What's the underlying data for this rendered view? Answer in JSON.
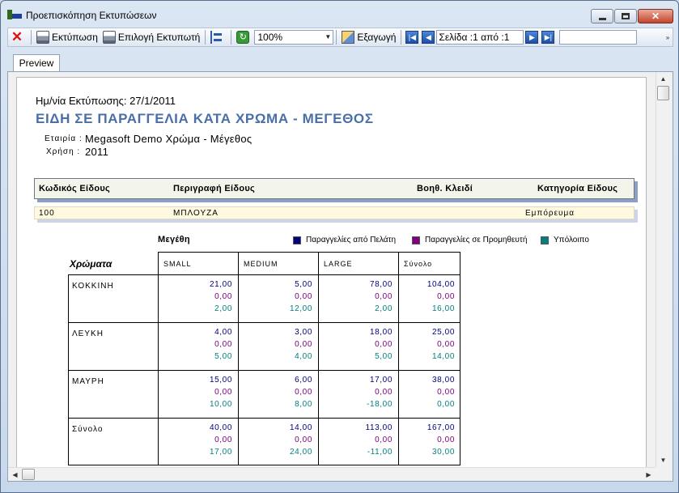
{
  "window": {
    "title": "Προεπισκόπηση Εκτυπώσεων"
  },
  "toolbar": {
    "print_label": "Εκτύπωση",
    "select_printer_label": "Επιλογή Εκτυπωτή",
    "zoom_value": "100%",
    "export_label": "Εξαγωγή",
    "page_indicator": "Σελίδα :1 από :1"
  },
  "tabs": [
    {
      "label": "Preview"
    }
  ],
  "report": {
    "print_date": "Ημ/νία Εκτύπωσης: 27/1/2011",
    "title": "ΕΙΔΗ ΣΕ ΠΑΡΑΓΓΕΛΙΑ ΚΑΤΑ ΧΡΩΜΑ - ΜΕΓΕΘΟΣ",
    "company_label": "Εταιρία :",
    "company_value": "Megasoft Demo Χρώμα - Μέγεθος",
    "year_label": "Χρήση :",
    "year_value": "2011",
    "columns": {
      "code": "Κωδικός Είδους",
      "description": "Περιγραφή Είδους",
      "aux_key": "Βοηθ. Κλειδί",
      "category": "Κατηγορία Είδους"
    },
    "item": {
      "code": "100",
      "description": "ΜΠΛΟΥΖΑ",
      "aux_key": "",
      "category": "Εμπόρευμα"
    },
    "matrix": {
      "sizes_title": "Μεγέθη",
      "colors_title": "Χρώματα",
      "legend": [
        {
          "label": "Παραγγελίες από Πελάτη",
          "color": "#000080"
        },
        {
          "label": "Παραγγελίες σε Προμηθευτή",
          "color": "#800080"
        },
        {
          "label": "Υπόλοιπο",
          "color": "#008080"
        }
      ],
      "value_colors": [
        "#000080",
        "#800080",
        "#008080"
      ],
      "size_headers": [
        "SMALL",
        "MEDIUM",
        "LARGE",
        "Σύνολο"
      ],
      "rows": [
        {
          "color": "ΚΟΚΚΙΝΗ",
          "cells": [
            [
              "21,00",
              "0,00",
              "2,00"
            ],
            [
              "5,00",
              "0,00",
              "12,00"
            ],
            [
              "78,00",
              "0,00",
              "2,00"
            ],
            [
              "104,00",
              "0,00",
              "16,00"
            ]
          ]
        },
        {
          "color": "ΛΕΥΚΗ",
          "cells": [
            [
              "4,00",
              "0,00",
              "5,00"
            ],
            [
              "3,00",
              "0,00",
              "4,00"
            ],
            [
              "18,00",
              "0,00",
              "5,00"
            ],
            [
              "25,00",
              "0,00",
              "14,00"
            ]
          ]
        },
        {
          "color": "ΜΑΥΡΗ",
          "cells": [
            [
              "15,00",
              "0,00",
              "10,00"
            ],
            [
              "6,00",
              "0,00",
              "8,00"
            ],
            [
              "17,00",
              "0,00",
              "-18,00"
            ],
            [
              "38,00",
              "0,00",
              "0,00"
            ]
          ]
        },
        {
          "color": "Σύνολο",
          "cells": [
            [
              "40,00",
              "0,00",
              "17,00"
            ],
            [
              "14,00",
              "0,00",
              "24,00"
            ],
            [
              "113,00",
              "0,00",
              "-11,00"
            ],
            [
              "167,00",
              "0,00",
              "30,00"
            ]
          ]
        }
      ]
    }
  }
}
